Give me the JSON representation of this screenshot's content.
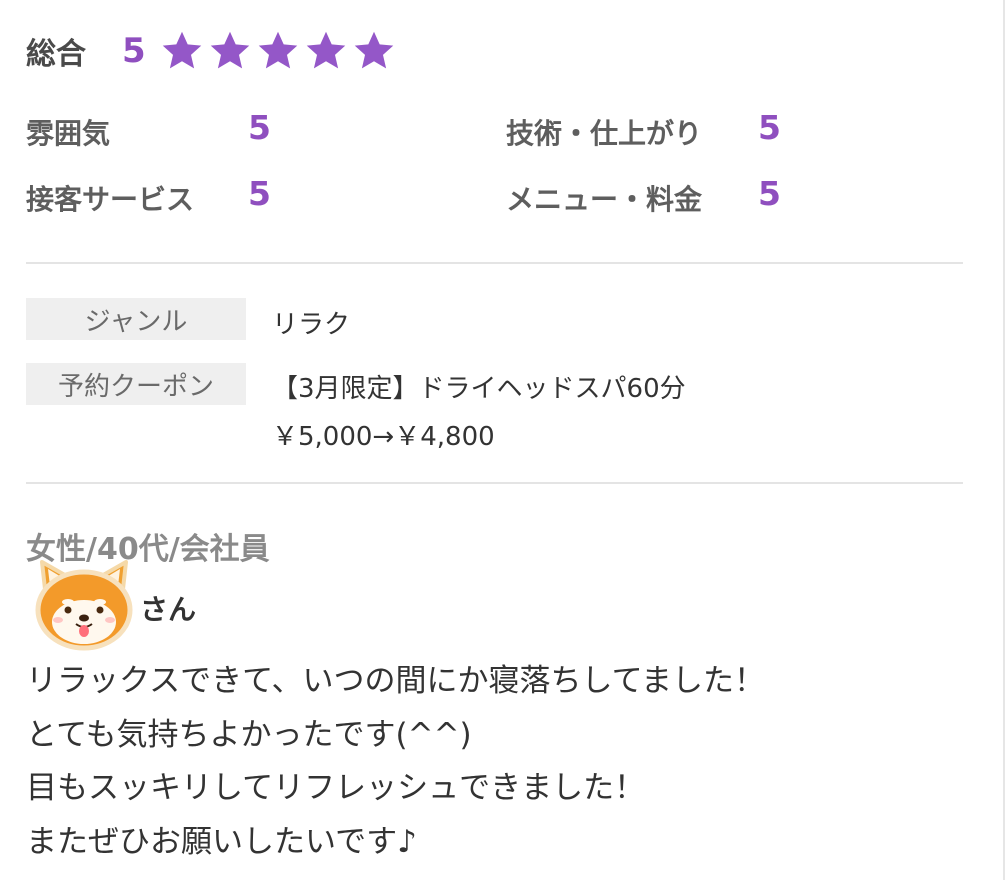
{
  "rating": {
    "overall_label": "総合",
    "overall_value": "5",
    "star_count": 5,
    "star_color": "#9457c8",
    "accent_color": "#8f4fbf",
    "atmosphere_label": "雰囲気",
    "atmosphere_value": "5",
    "technique_label": "技術・仕上がり",
    "technique_value": "5",
    "service_label": "接客サービス",
    "service_value": "5",
    "menu_label": "メニュー・料金",
    "menu_value": "5"
  },
  "details": {
    "genre_label": "ジャンル",
    "genre_value": "リラク",
    "coupon_label": "予約クーポン",
    "coupon_name": "【3月限定】ドライヘッドスパ60分",
    "coupon_price": "￥5,000→￥4,800"
  },
  "review": {
    "reviewer_meta": "女性/40代/会社員",
    "avatar_icon": "shiba-dog-avatar-icon",
    "nickname_suffix": "さん",
    "lines": [
      "リラックスできて、いつの間にか寝落ちしてました！",
      "とても気持ちよかったです(^^)",
      "目もスッキリしてリフレッシュできました！",
      "またぜひお願いしたいです♪"
    ]
  }
}
